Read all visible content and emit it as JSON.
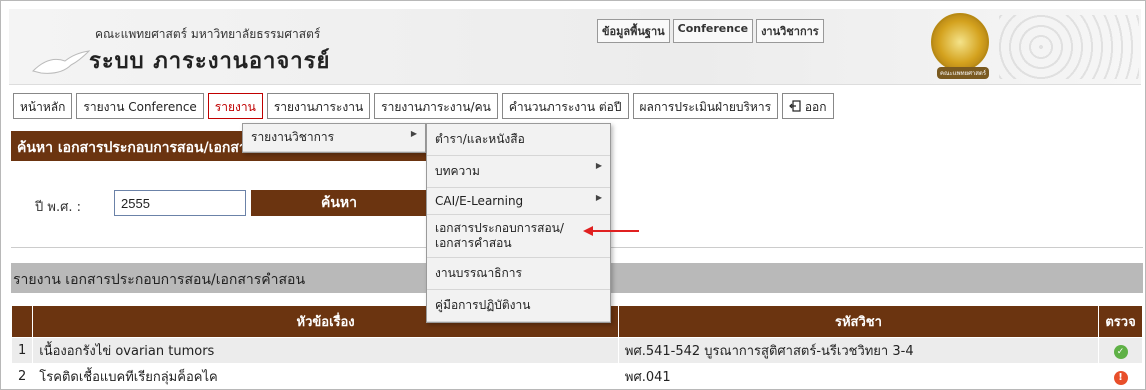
{
  "header": {
    "faculty": "คณะแพทยศาสตร์ มหาวิทยาลัยธรรมศาสตร์",
    "system_title": "ระบบ ภาระงานอาจารย์",
    "top_links": [
      "ข้อมูลพื้นฐาน",
      "Conference",
      "งานวิชาการ"
    ],
    "seal_text": "คณะแพทยศาสตร์"
  },
  "nav": {
    "tabs": [
      {
        "label": "หน้าหลัก"
      },
      {
        "label": "รายงาน Conference"
      },
      {
        "label": "รายงาน",
        "active": true
      },
      {
        "label": "รายงานภาระงาน"
      },
      {
        "label": "รายงานภาระงาน/คน"
      },
      {
        "label": "คำนวนภาระงาน ต่อปี"
      },
      {
        "label": "ผลการประเมินฝ่ายบริหาร"
      },
      {
        "label": "ออก",
        "icon": "logout-icon"
      }
    ]
  },
  "dropdown": {
    "submenu_label": "รายงานวิชาการ",
    "items": [
      {
        "label": "ตำรา/และหนังสือ"
      },
      {
        "label": "บทความ",
        "has_submenu": true
      },
      {
        "label": "CAI/E-Learning",
        "has_submenu": true
      },
      {
        "label_line1": "เอกสารประกอบการสอน/",
        "label_line2": "เอกสารคำสอน"
      },
      {
        "label": "งานบรรณาธิการ"
      },
      {
        "label": "คู่มือการปฏิบัติงาน"
      }
    ]
  },
  "search": {
    "title": "ค้นหา เอกสารประกอบการสอน/เอกสารคำสอน",
    "year_label": "ปี พ.ศ. :",
    "year_value": "2555",
    "button_label": "ค้นหา"
  },
  "report": {
    "title": "รายงาน เอกสารประกอบการสอน/เอกสารคำสอน",
    "columns": [
      "หัวข้อเรื่อง",
      "รหัสวิชา",
      "ตรวจ"
    ],
    "rows": [
      {
        "no": "1",
        "topic": "เนื้องอกรังไข่ ovarian tumors",
        "code": "พศ.541-542 บูรณาการสูติศาสตร์-นรีเวชวิทยา 3-4",
        "status": "approved-icon"
      },
      {
        "no": "2",
        "topic": "โรคติดเชื้อแบคทีเรียกลุ่มค็อคไค",
        "code": "พศ.041",
        "status": "alert-icon"
      }
    ]
  },
  "colors": {
    "accent": "#6b3410",
    "active_tab": "#c00000",
    "ok": "#5fb146",
    "warn": "#e84f2a",
    "pointer": "#e02020"
  }
}
